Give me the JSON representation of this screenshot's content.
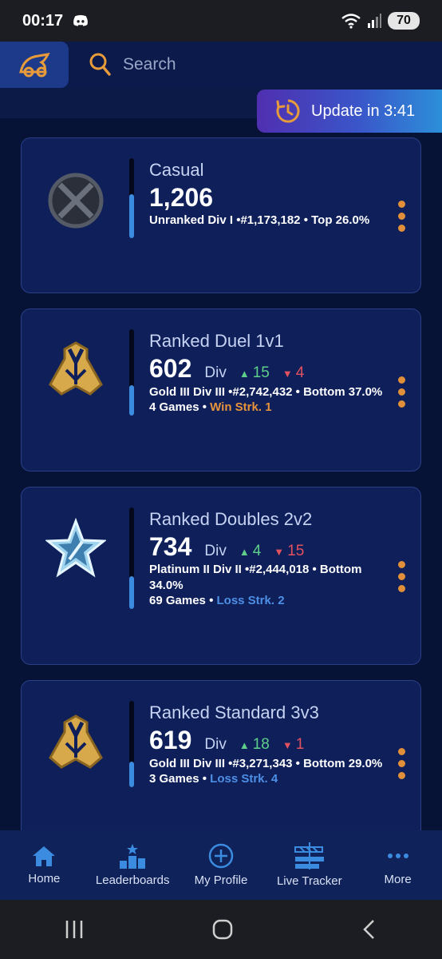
{
  "status_bar": {
    "time": "00:17",
    "battery": "70"
  },
  "search": {
    "label": "Search"
  },
  "update": {
    "label": "Update in 3:41"
  },
  "cards": [
    {
      "playlist": "Casual",
      "rating": "1,206",
      "detail": "Unranked Div I •#1,173,182 • Top 26.0%",
      "progress": 0.55
    },
    {
      "playlist": "Ranked Duel 1v1",
      "rating": "602",
      "div_label": "Div",
      "div_up": "15",
      "div_down": "4",
      "detail": "Gold III Div III •#2,742,432 • Bottom 37.0%",
      "games": "4 Games",
      "separator": "•",
      "streak": "Win Strk. 1",
      "progress": 0.35
    },
    {
      "playlist": "Ranked Doubles 2v2",
      "rating": "734",
      "div_label": "Div",
      "div_up": "4",
      "div_down": "15",
      "detail": "Platinum II Div II •#2,444,018 • Bottom 34.0%",
      "games": "69 Games",
      "separator": "•",
      "streak": "Loss Strk. 2",
      "progress": 0.32
    },
    {
      "playlist": "Ranked Standard 3v3",
      "rating": "619",
      "div_label": "Div",
      "div_up": "18",
      "div_down": "1",
      "detail": "Gold III Div III •#3,271,343 • Bottom 29.0%",
      "games": "3 Games",
      "separator": "•",
      "streak": "Loss Strk. 4",
      "progress": 0.3
    }
  ],
  "nav": {
    "home": "Home",
    "leaderboards": "Leaderboards",
    "my_profile": "My Profile",
    "live_tracker": "Live Tracker",
    "more": "More"
  },
  "colors": {
    "background": "#061236",
    "card": "#0e1f5a",
    "accent_blue": "#3b8be0",
    "up_green": "#5fd08a",
    "down_red": "#e2525e",
    "win_orange": "#e7933c",
    "loss_blue": "#4e8fe6"
  },
  "icons": [
    "discord-icon",
    "wifi-icon",
    "signal-icon",
    "rocket-league-logo",
    "search-icon",
    "update-timer-icon",
    "unranked-icon",
    "gold-rank-icon",
    "platinum-rank-icon",
    "kebab-menu-icon",
    "home-icon",
    "leaderboards-icon",
    "my-profile-icon",
    "live-tracker-icon",
    "more-icon"
  ]
}
